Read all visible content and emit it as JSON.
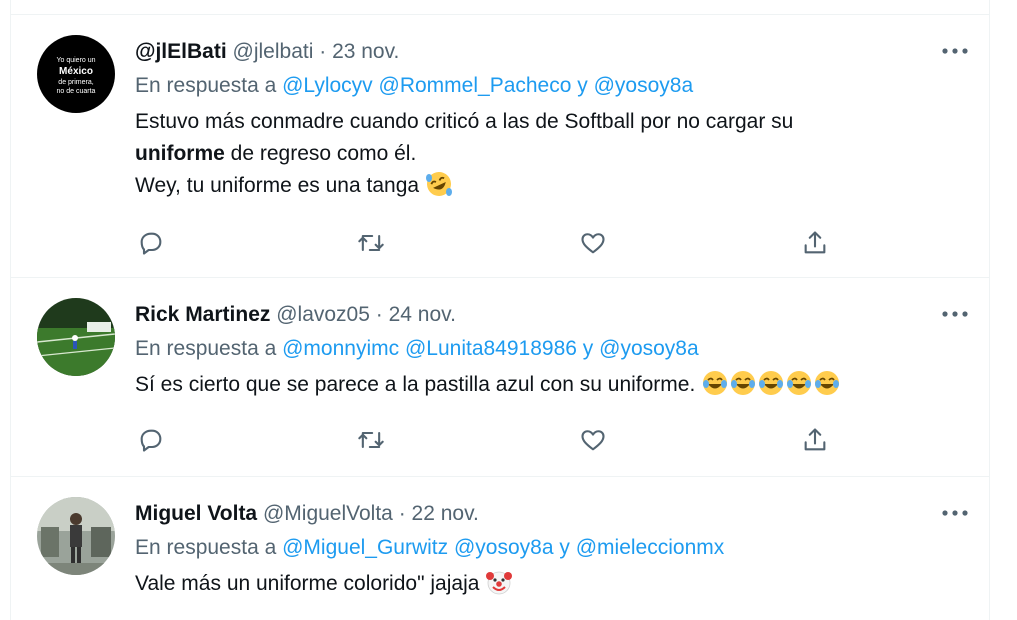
{
  "tweets": [
    {
      "name": "@jlElBati",
      "handle": "@jlelbati",
      "separator": "·",
      "date": "23 nov.",
      "reply_prefix": "En respuesta a",
      "mentions": [
        "@Lylocyv",
        "@Rommel_Pacheco",
        "@yosoy8a"
      ],
      "mention_joiner": "y",
      "body_line1": "Estuvo más conmadre cuando criticó a las de Softball por no cargar su",
      "body_line2_bold": "uniforme",
      "body_line2_rest": " de regreso como él.",
      "body_line3": "Wey, tu uniforme es una tanga",
      "avatar_text": [
        "Yo quiero un",
        "México",
        "de primera,",
        "no de cuarta"
      ],
      "body_emoji": "rolling-on-floor-laughing-emoji"
    },
    {
      "name": "Rick Martinez",
      "handle": "@lavoz05",
      "separator": "·",
      "date": "24 nov.",
      "reply_prefix": "En respuesta a",
      "mentions": [
        "@monnyimc",
        "@Lunita84918986",
        "@yosoy8a"
      ],
      "mention_joiner": "y",
      "body_line1": "Sí es cierto que se parece a la pastilla azul con su uniforme.",
      "body_emoji": "face-with-tears-of-joy-emoji",
      "body_emoji_count": 5
    },
    {
      "name": "Miguel Volta",
      "handle": "@MiguelVolta",
      "separator": "·",
      "date": "22 nov.",
      "reply_prefix": "En respuesta a",
      "mentions": [
        "@Miguel_Gurwitz",
        "@yosoy8a",
        "@mieleccionmx"
      ],
      "mention_joiner": "y",
      "body_line1": "Vale más un uniforme colorido\" jajaja",
      "body_emoji": "clown-face-emoji"
    }
  ],
  "icons": {
    "reply": "reply-icon",
    "retweet": "retweet-icon",
    "like": "like-icon",
    "share": "share-icon",
    "more": "more-icon"
  },
  "colors": {
    "link": "#1d9bf0",
    "secondary": "#536471",
    "primary_text": "#0f1419",
    "divider": "#eff3f4"
  }
}
